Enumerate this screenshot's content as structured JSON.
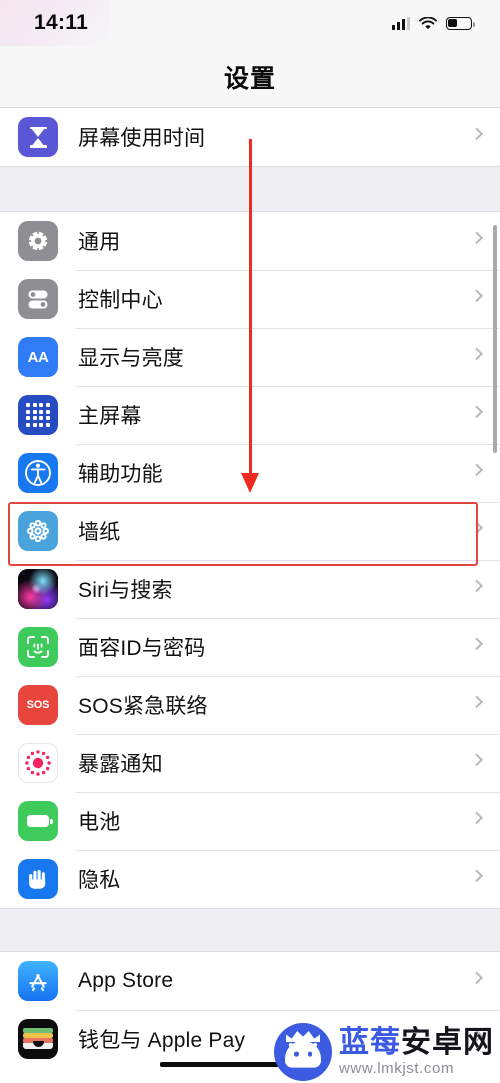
{
  "status_bar": {
    "time": "14:11",
    "signal_icon": "cellular-signal-icon",
    "wifi_icon": "wifi-icon",
    "battery_icon": "battery-icon",
    "battery_level_pct": 34
  },
  "nav": {
    "title": "设置"
  },
  "sections": [
    {
      "id": "screen-time",
      "rows": [
        {
          "label": "屏幕使用时间",
          "icon": "hourglass-icon",
          "icon_class": "ic-screentime",
          "color": "#5A57D6"
        }
      ]
    },
    {
      "id": "system",
      "rows": [
        {
          "label": "通用",
          "icon": "gear-icon",
          "icon_class": "ic-general",
          "color": "#8E8E93"
        },
        {
          "label": "控制中心",
          "icon": "toggles-icon",
          "icon_class": "ic-controlcenter",
          "color": "#8E8E93"
        },
        {
          "label": "显示与亮度",
          "icon": "aa-text-icon",
          "icon_class": "ic-display",
          "color": "#2F7CF6"
        },
        {
          "label": "主屏幕",
          "icon": "app-grid-icon",
          "icon_class": "ic-home",
          "color": "#274BC0"
        },
        {
          "label": "辅助功能",
          "icon": "accessibility-icon",
          "icon_class": "ic-access",
          "color": "#1878F0"
        },
        {
          "label": "墙纸",
          "icon": "wallpaper-flower-icon",
          "icon_class": "ic-wallpaper",
          "color": "#4BA3DC",
          "highlighted": true
        },
        {
          "label": "Siri与搜索",
          "icon": "siri-orb-icon",
          "icon_class": "ic-siri",
          "color": "#07060B"
        },
        {
          "label": "面容ID与密码",
          "icon": "face-id-icon",
          "icon_class": "ic-faceid",
          "color": "#3FCB5C"
        },
        {
          "label": "SOS紧急联络",
          "icon": "sos-icon",
          "icon_class": "ic-sos",
          "color": "#E8453C"
        },
        {
          "label": "暴露通知",
          "icon": "exposure-dots-icon",
          "icon_class": "ic-exposure",
          "color": "#F5265F"
        },
        {
          "label": "电池",
          "icon": "battery-icon",
          "icon_class": "ic-battery",
          "color": "#3FCB5C"
        },
        {
          "label": "隐私",
          "icon": "hand-icon",
          "icon_class": "ic-privacy",
          "color": "#1878F0"
        }
      ]
    },
    {
      "id": "store",
      "rows": [
        {
          "label": "App Store",
          "icon": "app-store-icon",
          "icon_class": "ic-appstore",
          "color": "#1772F0"
        },
        {
          "label": "钱包与 Apple Pay",
          "icon": "wallet-icon",
          "icon_class": "ic-wallet",
          "color": "#0C0C0E"
        }
      ]
    }
  ],
  "annotations": {
    "arrow_color": "#EE2B22",
    "highlight_box_color": "#E0473F",
    "highlight_target": "墙纸",
    "underline_color": "#0A0A0A"
  },
  "watermark": {
    "site_name_part1": "蓝莓",
    "site_name_part2": "安卓网",
    "url": "www.lmkjst.com",
    "logo_icon": "android-robot-crown-icon",
    "brand_color": "#3B5BE0"
  }
}
